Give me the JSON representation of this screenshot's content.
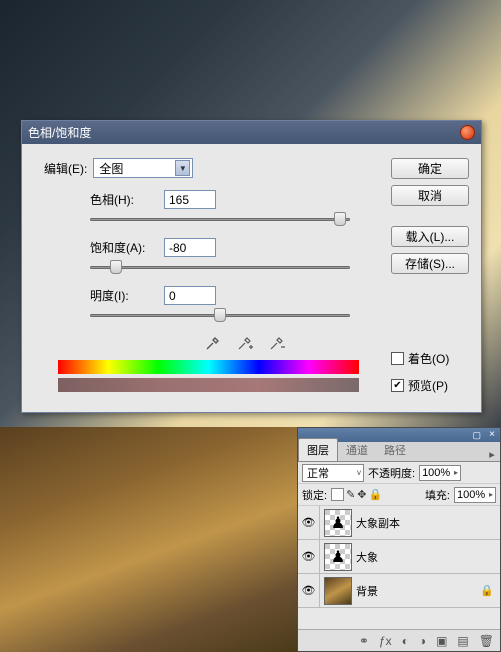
{
  "dialog": {
    "title": "色相/饱和度",
    "edit_label": "编辑(E):",
    "edit_value": "全图",
    "hue_label": "色相(H):",
    "hue_value": "165",
    "sat_label": "饱和度(A):",
    "sat_value": "-80",
    "light_label": "明度(I):",
    "light_value": "0",
    "buttons": {
      "ok": "确定",
      "cancel": "取消",
      "load": "载入(L)...",
      "save": "存储(S)..."
    },
    "colorize_label": "着色(O)",
    "preview_label": "预览(P)",
    "preview_checked": true
  },
  "chart_data": {
    "type": "sliders",
    "sliders": [
      {
        "name": "hue",
        "label": "色相(H)",
        "min": -180,
        "max": 180,
        "value": 165
      },
      {
        "name": "saturation",
        "label": "饱和度(A)",
        "min": -100,
        "max": 100,
        "value": -80
      },
      {
        "name": "lightness",
        "label": "明度(I)",
        "min": -100,
        "max": 100,
        "value": 0
      }
    ]
  },
  "layers_panel": {
    "tabs": {
      "layers": "图层",
      "channels": "通道",
      "paths": "路径"
    },
    "blend_mode": "正常",
    "opacity_label": "不透明度:",
    "opacity_value": "100%",
    "lock_label": "锁定:",
    "fill_label": "填充:",
    "fill_value": "100%",
    "items": [
      {
        "name": "大象副本",
        "visible": true,
        "locked": false
      },
      {
        "name": "大象",
        "visible": true,
        "locked": false
      },
      {
        "name": "背景",
        "visible": true,
        "locked": true
      }
    ]
  }
}
